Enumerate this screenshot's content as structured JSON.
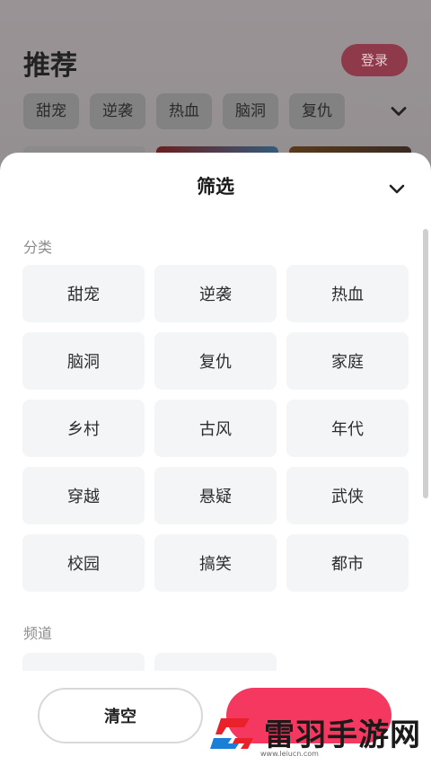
{
  "background": {
    "title": "推荐",
    "login_label": "登录",
    "tags": [
      "甜宠",
      "逆袭",
      "热血",
      "脑洞",
      "复仇"
    ],
    "more_icon": "chevron-down-icon"
  },
  "filter_sheet": {
    "title": "筛选",
    "collapse_icon": "chevron-down-icon",
    "category_section": {
      "label": "分类",
      "options": [
        "甜宠",
        "逆袭",
        "热血",
        "脑洞",
        "复仇",
        "家庭",
        "乡村",
        "古风",
        "年代",
        "穿越",
        "悬疑",
        "武侠",
        "校园",
        "搞笑",
        "都市"
      ]
    },
    "channel_section": {
      "label": "频道"
    },
    "clear_label": "清空"
  },
  "watermark": {
    "text": "雷羽手游网",
    "url": "www.leiucn.com",
    "colors": {
      "red": "#e8212b",
      "blue": "#1a7fd6"
    }
  },
  "colors": {
    "accent": "#f5385f",
    "chip_bg": "#f4f5f7"
  }
}
